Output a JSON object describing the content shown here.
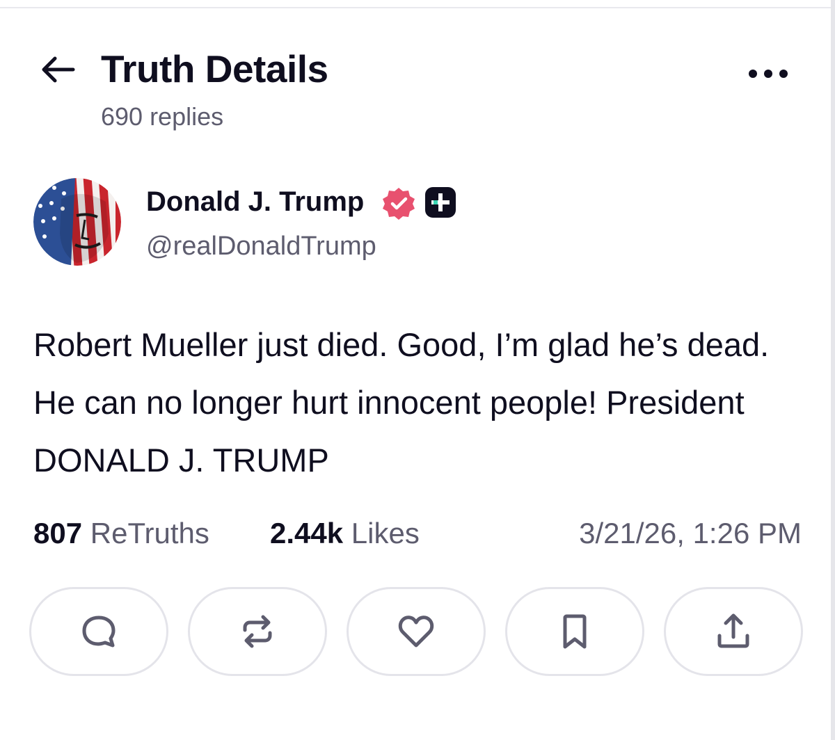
{
  "header": {
    "title": "Truth Details",
    "reply_count": "690 replies",
    "back_icon": "arrow-left-icon",
    "more_icon": "more-horizontal-icon"
  },
  "author": {
    "name": "Donald J. Trump",
    "handle": "@realDonaldTrump",
    "verified_color": "#e8516f",
    "badge_icon": "truth-plus-badge-icon"
  },
  "post": {
    "body": "Robert Mueller just died. Good, I’m glad he’s dead. He can no longer hurt innocent people! President DONALD J. TRUMP"
  },
  "stats": {
    "retruths_count": "807",
    "retruths_label": "ReTruths",
    "likes_count": "2.44k",
    "likes_label": "Likes",
    "timestamp": "3/21/26, 1:26 PM"
  },
  "actions": [
    {
      "name": "reply",
      "icon": "chat-bubble-icon"
    },
    {
      "name": "retruth",
      "icon": "repost-icon"
    },
    {
      "name": "like",
      "icon": "heart-icon"
    },
    {
      "name": "bookmark",
      "icon": "bookmark-icon"
    },
    {
      "name": "share",
      "icon": "share-upload-icon"
    }
  ],
  "colors": {
    "text_primary": "#0f0e1f",
    "text_secondary": "#5d5c6e",
    "button_border": "#e4e4ea"
  }
}
